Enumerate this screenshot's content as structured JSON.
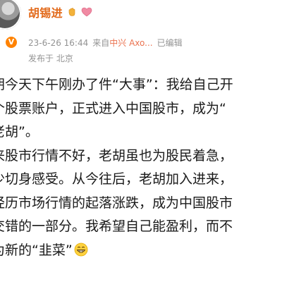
{
  "header": {
    "user_name": "胡锡进",
    "timestamp": "23-6-26 16:44",
    "source_prefix": "来自",
    "source_name": "中兴 Axo...",
    "edited_label": "已编辑",
    "location": "发布于 北京",
    "verified_badge": "V"
  },
  "post": {
    "lines": [
      "胡今天下午刚办了件“大事”：我给自己开",
      "个股票账户，正式进入中国股市，成为“",
      "老胡”。",
      "来股市行情不好，老胡虽也为股民着急，",
      "少切身感受。从今往后，老胡加入进来，",
      "经历市场行情的起落涨跌，成为中国股市",
      "交错的一部分。我希望自己能盈利，而不",
      "为新的“韭菜”"
    ],
    "next_line_fragment": "…"
  },
  "icons": {
    "avatar": "avatar-photo",
    "verified": "verified-badge-icon",
    "hand": "hand-wave-icon",
    "heart": "heart-icon",
    "emoji": "grinning-emoji-icon"
  },
  "colors": {
    "name": "#e26a1b",
    "meta": "#939393",
    "source": "#eb7350",
    "badge": "#ff8200"
  }
}
